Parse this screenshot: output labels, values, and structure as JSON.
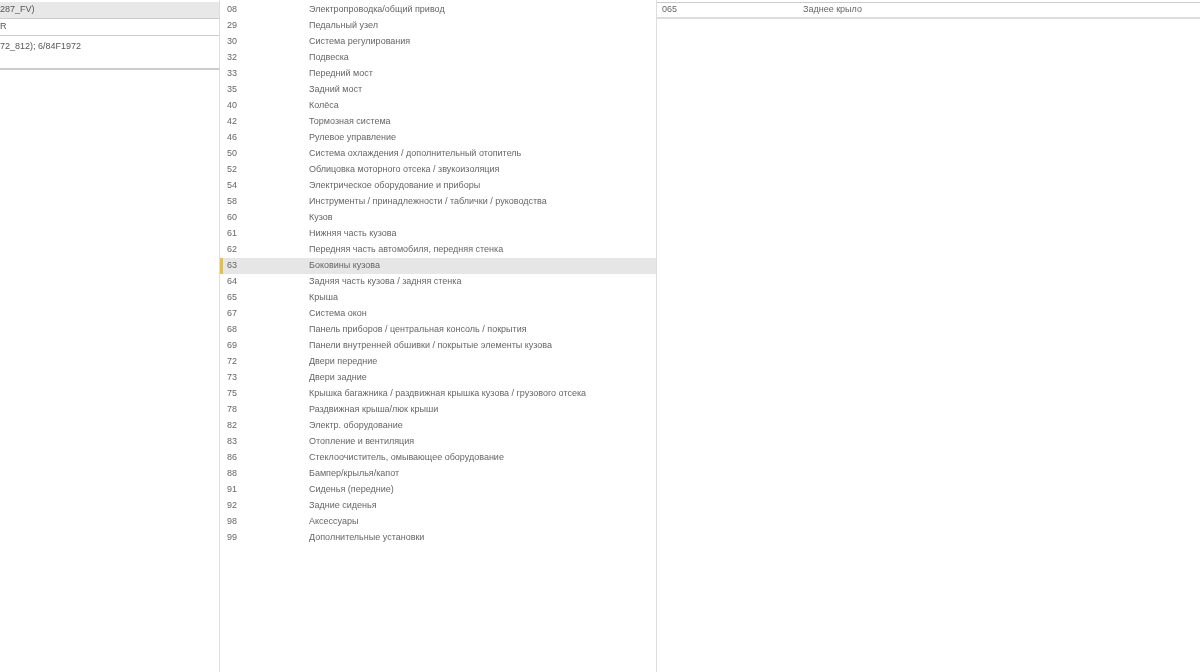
{
  "models": [
    {
      "text": "287_FV)",
      "selected": true
    },
    {
      "text": "R",
      "selected": false
    },
    {
      "text": "72_812); 6/84F1972",
      "selected": false
    }
  ],
  "groups": [
    {
      "code": "08",
      "name": "Электропроводка/общий привод",
      "selected": false
    },
    {
      "code": "29",
      "name": "Педальный узел",
      "selected": false
    },
    {
      "code": "30",
      "name": "Система регулирования",
      "selected": false
    },
    {
      "code": "32",
      "name": "Подвеска",
      "selected": false
    },
    {
      "code": "33",
      "name": "Передний мост",
      "selected": false
    },
    {
      "code": "35",
      "name": "Задний мост",
      "selected": false
    },
    {
      "code": "40",
      "name": "Колёса",
      "selected": false
    },
    {
      "code": "42",
      "name": "Тормозная система",
      "selected": false
    },
    {
      "code": "46",
      "name": "Рулевое управление",
      "selected": false
    },
    {
      "code": "50",
      "name": "Система охлаждения / дополнительный отопитель",
      "selected": false
    },
    {
      "code": "52",
      "name": "Облицовка моторного отсека / звукоизоляция",
      "selected": false
    },
    {
      "code": "54",
      "name": "Электрическое оборудование и приборы",
      "selected": false
    },
    {
      "code": "58",
      "name": "Инструменты / принадлежности / таблички / руководства",
      "selected": false
    },
    {
      "code": "60",
      "name": "Кузов",
      "selected": false
    },
    {
      "code": "61",
      "name": "Нижняя часть кузова",
      "selected": false
    },
    {
      "code": "62",
      "name": "Передняя часть автомобиля, передняя стенка",
      "selected": false
    },
    {
      "code": "63",
      "name": "Боковины кузова",
      "selected": true
    },
    {
      "code": "64",
      "name": "Задняя часть кузова / задняя стенка",
      "selected": false
    },
    {
      "code": "65",
      "name": "Крыша",
      "selected": false
    },
    {
      "code": "67",
      "name": "Система окон",
      "selected": false
    },
    {
      "code": "68",
      "name": "Панель приборов / центральная консоль / покрытия",
      "selected": false
    },
    {
      "code": "69",
      "name": "Панели внутренней обшивки / покрытые элементы кузова",
      "selected": false
    },
    {
      "code": "72",
      "name": "Двери передние",
      "selected": false
    },
    {
      "code": "73",
      "name": "Двери задние",
      "selected": false
    },
    {
      "code": "75",
      "name": "Крышка багажника / раздвижная крышка кузова / грузового отсека",
      "selected": false
    },
    {
      "code": "78",
      "name": "Раздвижная крыша/люк крыши",
      "selected": false
    },
    {
      "code": "82",
      "name": "Электр. оборудование",
      "selected": false
    },
    {
      "code": "83",
      "name": "Отопление и вентиляция",
      "selected": false
    },
    {
      "code": "86",
      "name": "Стеклоочиститель, омывающее оборудование",
      "selected": false
    },
    {
      "code": "88",
      "name": "Бампер/крылья/капот",
      "selected": false
    },
    {
      "code": "91",
      "name": "Сиденья (передние)",
      "selected": false
    },
    {
      "code": "92",
      "name": "Задние сиденья",
      "selected": false
    },
    {
      "code": "98",
      "name": "Аксессуары",
      "selected": false
    },
    {
      "code": "99",
      "name": "Дополнительные установки",
      "selected": false
    }
  ],
  "subgroups": [
    {
      "code": "065",
      "name": "Заднее крыло"
    }
  ]
}
